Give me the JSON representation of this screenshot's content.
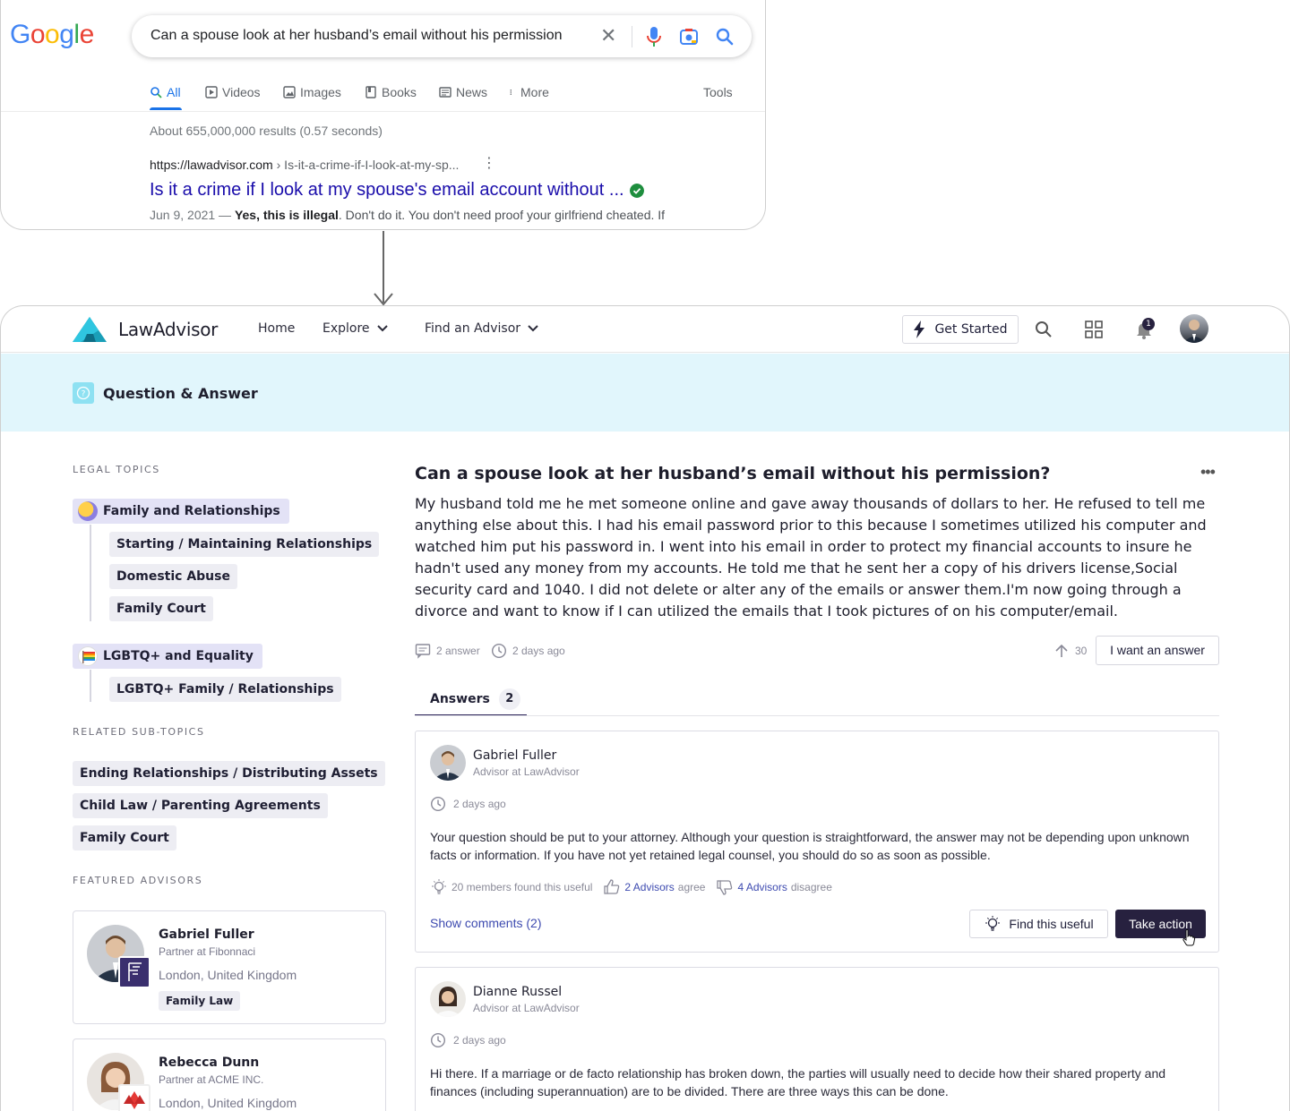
{
  "google": {
    "logo_letters": [
      {
        "ch": "G",
        "color": "#4285F4"
      },
      {
        "ch": "o",
        "color": "#EA4335"
      },
      {
        "ch": "o",
        "color": "#FBBC05"
      },
      {
        "ch": "g",
        "color": "#4285F4"
      },
      {
        "ch": "l",
        "color": "#34A853"
      },
      {
        "ch": "e",
        "color": "#EA4335"
      }
    ],
    "query": "Can a spouse look at her husband’s email without his permission",
    "tabs": [
      {
        "label": "All",
        "icon": "search-icon",
        "active": true
      },
      {
        "label": "Videos",
        "icon": "play-icon"
      },
      {
        "label": "Images",
        "icon": "image-icon"
      },
      {
        "label": "Books",
        "icon": "book-icon"
      },
      {
        "label": "News",
        "icon": "news-icon"
      },
      {
        "label": "More",
        "icon": "more-vert-icon"
      }
    ],
    "tools_label": "Tools",
    "stats": "About 655,000,000 results (0.57 seconds)",
    "result": {
      "url_domain": "https://lawadvisor.com",
      "url_path": " › Is-it-a-crime-if-I-look-at-my-sp...",
      "title": "Is it a crime if I look at my spouse's email account without ...",
      "date": "Jun 9, 2021 — ",
      "snippet_bold": "Yes, this is illegal",
      "snippet_rest": ". Don't do it. You don't need proof your girlfriend cheated. If"
    }
  },
  "lawadvisor": {
    "brand": "LawAdvisor",
    "nav": {
      "home": "Home",
      "explore": "Explore",
      "find_advisor": "Find an Advisor",
      "get_started": "Get Started",
      "notif_count": "1"
    },
    "banner_title": "Question & Answer",
    "sidebar": {
      "legal_topics_heading": "LEGAL TOPICS",
      "topic1": "Family and Relationships",
      "topic1_subs": [
        "Starting / Maintaining Relationships",
        "Domestic Abuse",
        "Family Court"
      ],
      "topic2": "LGBTQ+ and Equality",
      "topic2_subs": [
        "LGBTQ+ Family / Relationships"
      ],
      "related_heading": "RELATED SUB-TOPICS",
      "related": [
        "Ending Relationships / Distributing Assets",
        "Child Law /  Parenting Agreements",
        "Family Court"
      ],
      "featured_heading": "FEATURED ADVISORS",
      "advisors": [
        {
          "name": "Gabriel Fuller",
          "role": "Partner at Fibonnaci",
          "location": "London, United Kingdom",
          "tag": "Family Law"
        },
        {
          "name": "Rebecca Dunn",
          "role": "Partner at ACME INC.",
          "location": "London, United Kingdom",
          "tag": ""
        }
      ]
    },
    "question": {
      "title": "Can a spouse look at her husband’s email without his permission?",
      "body": "My husband told me he met someone online and gave away thousands of dollars to her. He refused to tell me anything else about this. I had his email password prior to this because I sometimes utilized his computer and watched him put his password in. I went into his email in order to protect my financial accounts to insure he hadn't used any money from my accounts. He told me that he sent her a copy of his drivers license,Social security card and 1040. I did not delete or alter any of the emails or answer them.I'm now going through a divorce and want to know if I can utilized the emails that I took pictures of on his computer/email.",
      "answer_count_label": "2 answer",
      "time": "2 days ago",
      "votes": "30",
      "want_answer": "I want an answer"
    },
    "answers_tab": {
      "label": "Answers",
      "count": "2"
    },
    "answers": [
      {
        "name": "Gabriel Fuller",
        "role": "Advisor at LawAdvisor",
        "time": "2 days ago",
        "body": "Your question should be put to your attorney. Although your question is straightforward, the answer may not be depending upon unknown facts or information. If you have not yet retained legal counsel, you should do so as soon as possible.",
        "useful": "20 members found this useful",
        "agree_link": "2 Advisors",
        "agree_text": "agree",
        "disagree_link": "4 Advisors",
        "disagree_text": "disagree",
        "show_comments": "Show comments (2)",
        "find_useful": "Find this useful",
        "take_action": "Take action"
      },
      {
        "name": "Dianne Russel",
        "role": "Advisor at LawAdvisor",
        "time": "2 days ago",
        "body": "Hi there. If a marriage or de facto relationship has broken down, the parties will usually need to decide how their shared property and finances (including superannuation) are to be divided. There are three ways this can be done."
      }
    ]
  }
}
